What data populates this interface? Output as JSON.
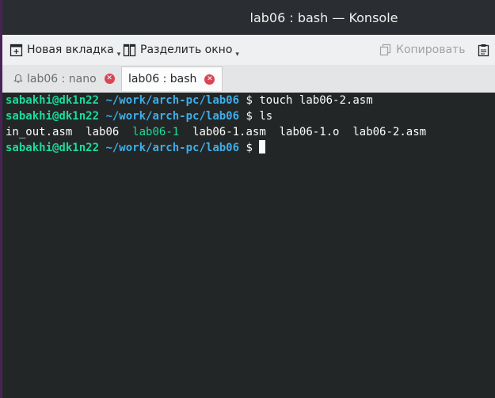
{
  "window": {
    "title": "lab06 : bash — Konsole"
  },
  "toolbar": {
    "new_tab_label": "Новая вкладка",
    "split_label": "Разделить окно",
    "copy_label": "Копировать"
  },
  "tabs": [
    {
      "label": "lab06 : nano",
      "active": false
    },
    {
      "label": "lab06 : bash",
      "active": true
    }
  ],
  "terminal": {
    "prompt_user": "sabakhi@dk1n22",
    "prompt_path": "~/work/arch-pc/lab06",
    "prompt_symbol": "$",
    "lines": [
      {
        "command": "touch lab06-2.asm"
      },
      {
        "command": "ls"
      }
    ],
    "ls_output": [
      "in_out.asm",
      "lab06",
      "lab06-1",
      "lab06-1.asm",
      "lab06-1.o",
      "lab06-2.asm"
    ],
    "colors": {
      "user": "#1cdc9a",
      "path": "#3daee9",
      "executable": "#1cdc9a",
      "text": "#fcfcfc"
    }
  }
}
